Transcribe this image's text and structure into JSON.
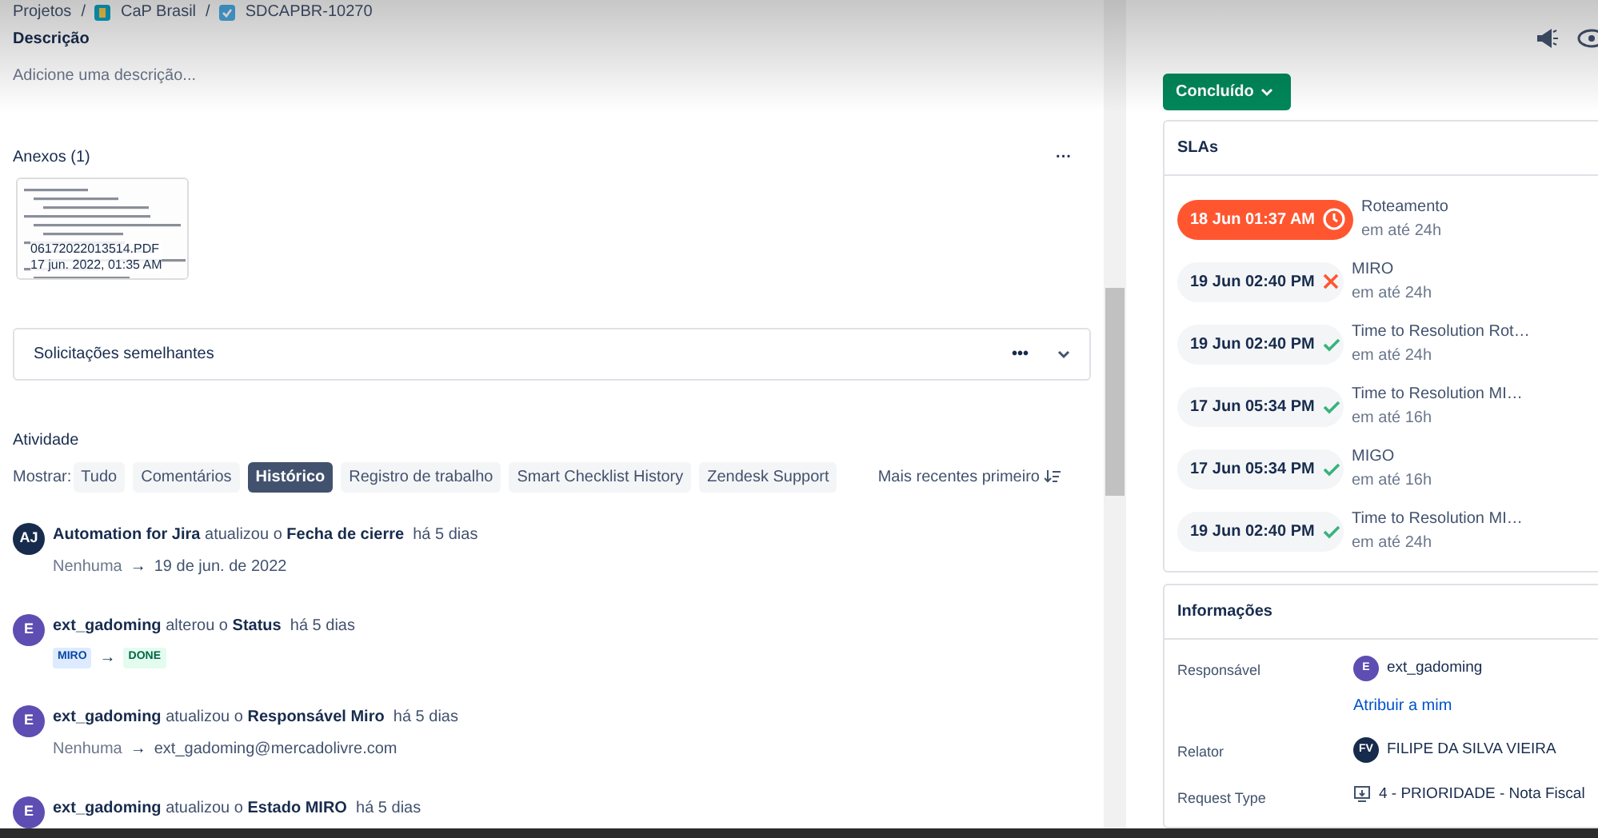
{
  "breadcrumb": [
    {
      "label": "Projetos",
      "kind": "text"
    },
    {
      "separator": "/",
      "label": "CaP Brasil",
      "kind": "project"
    },
    {
      "separator": "/",
      "label": "SDCAPBR-10270",
      "kind": "issue"
    }
  ],
  "description": {
    "title": "Descrição",
    "placeholder": "Adicione uma descrição..."
  },
  "attachments": {
    "title": "Anexos (1)",
    "menu": "···",
    "files": [
      {
        "name": "06172022013514.PDF",
        "date": "17 jun. 2022, 01:35 AM"
      }
    ]
  },
  "similar": {
    "title": "Solicitações semelhantes",
    "menu": "•••"
  },
  "activity": {
    "title": "Atividade",
    "filter_label": "Mostrar:",
    "filters": [
      {
        "label": "Tudo",
        "selected": false
      },
      {
        "label": "Comentários",
        "selected": false
      },
      {
        "label": "Histórico",
        "selected": true
      },
      {
        "label": "Registro de trabalho",
        "selected": false
      },
      {
        "label": "Smart Checklist History",
        "selected": false
      },
      {
        "label": "Zendesk Support",
        "selected": false
      }
    ],
    "sort_label": "Mais recentes primeiro",
    "items": [
      {
        "avatar": "AJ",
        "color": "#172b4d",
        "actor": "Automation for Jira",
        "verb": "atualizou o",
        "field": "Fecha de cierre",
        "time": "há 5 dias",
        "kind": "text",
        "from": "Nenhuma",
        "arrow": "→",
        "to": "19 de jun. de 2022"
      },
      {
        "avatar": "E",
        "color": "#5e4db2",
        "actor": "ext_gadoming",
        "verb": "alterou o",
        "field": "Status",
        "time": "há 5 dias",
        "kind": "lozenge",
        "from": "MIRO",
        "arrow": "→",
        "to": "DONE"
      },
      {
        "avatar": "E",
        "color": "#5e4db2",
        "actor": "ext_gadoming",
        "verb": "atualizou o",
        "field": "Responsável Miro",
        "time": "há 5 dias",
        "kind": "text",
        "from": "Nenhuma",
        "arrow": "→",
        "to": "ext_gadoming@mercadolivre.com"
      },
      {
        "avatar": "E",
        "color": "#5e4db2",
        "actor": "ext_gadoming",
        "verb": "atualizou o",
        "field": "Estado MIRO",
        "time": "há 5 dias",
        "kind": "none"
      }
    ]
  },
  "status_button": {
    "label": "Concluído"
  },
  "slas": {
    "title": "SLAs",
    "items": [
      {
        "time": "18 Jun 01:37 AM",
        "kind": "running",
        "name": "Roteamento",
        "goal": "em até 24h"
      },
      {
        "time": "19 Jun 02:40 PM",
        "kind": "failed",
        "name": "MIRO",
        "goal": "em até 24h"
      },
      {
        "time": "19 Jun 02:40 PM",
        "kind": "met",
        "name": "Time to Resolution Rot…",
        "goal": "em até 24h"
      },
      {
        "time": "17 Jun 05:34 PM",
        "kind": "met",
        "name": "Time to Resolution MI…",
        "goal": "em até 16h"
      },
      {
        "time": "17 Jun 05:34 PM",
        "kind": "met",
        "name": "MIGO",
        "goal": "em até 16h"
      },
      {
        "time": "19 Jun 02:40 PM",
        "kind": "met",
        "name": "Time to Resolution MI…",
        "goal": "em até 24h"
      }
    ]
  },
  "info": {
    "title": "Informações",
    "fields": [
      {
        "label": "Responsável",
        "kind": "user",
        "avatar": "E",
        "color": "#5e4db2",
        "value": "ext_gadoming",
        "link": "Atribuir a mim"
      },
      {
        "label": "Relator",
        "kind": "user",
        "avatar": "FV",
        "color": "#172b4d",
        "value": "FILIPE DA SILVA VIEIRA"
      },
      {
        "label": "Request Type",
        "kind": "request",
        "value": "4 - PRIORIDADE - Nota Fiscal"
      }
    ]
  }
}
